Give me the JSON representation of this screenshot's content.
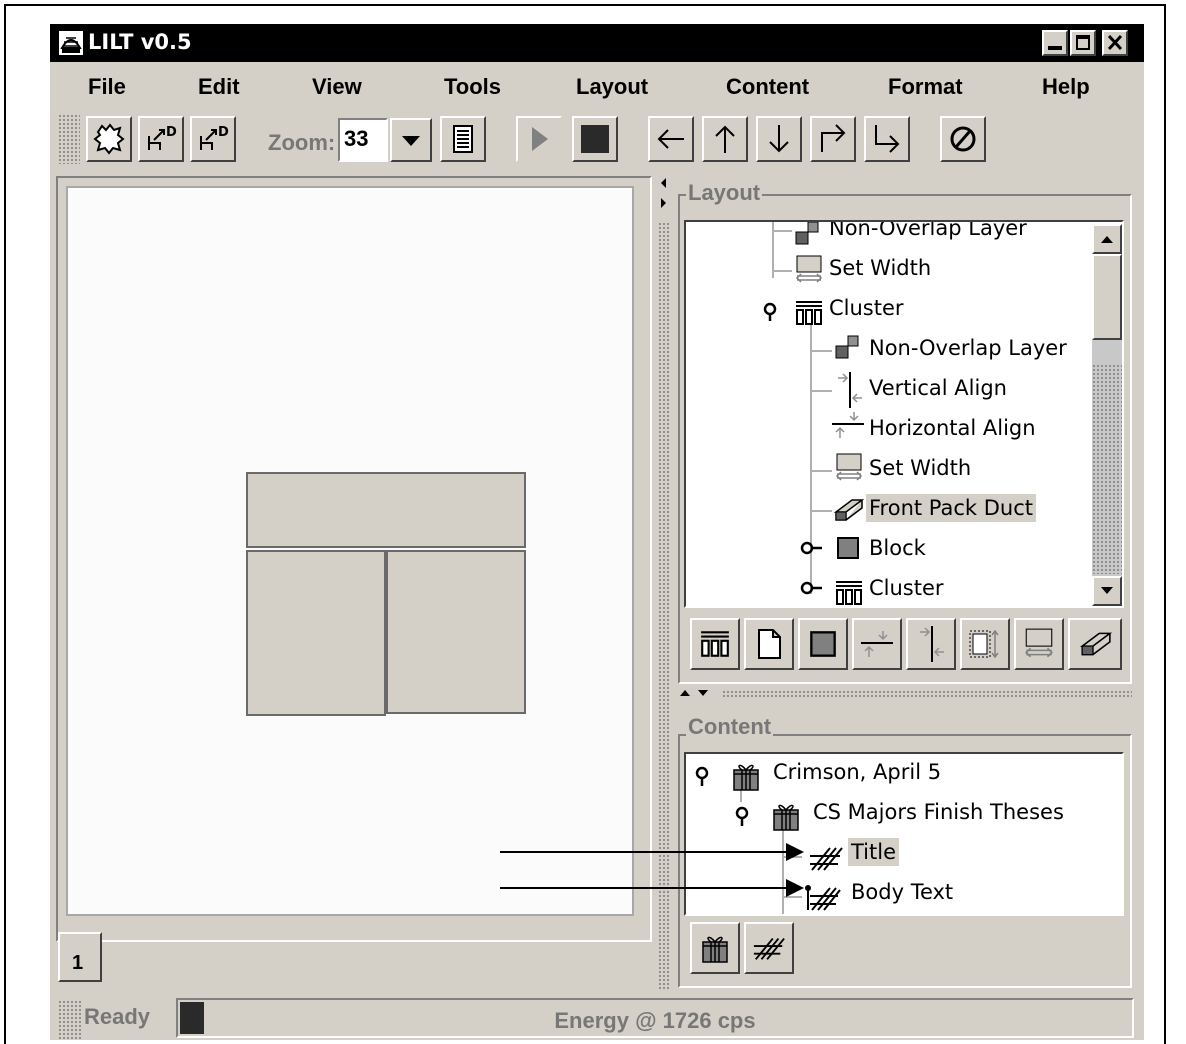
{
  "window": {
    "title": "LILT v0.5"
  },
  "menu": [
    "File",
    "Edit",
    "View",
    "Tools",
    "Layout",
    "Content",
    "Format",
    "Help"
  ],
  "toolbar": {
    "zoom_label": "Zoom:",
    "zoom_value": "33",
    "icons": [
      "new-layout-icon",
      "export-icon",
      "export-alt-icon",
      "dropdown-arrow-icon",
      "page-view-icon",
      "play-icon",
      "stop-icon",
      "arrow-left-icon",
      "arrow-up-icon",
      "arrow-down-icon",
      "redo-arrow-icon",
      "enter-arrow-icon",
      "cancel-icon"
    ]
  },
  "canvas": {
    "page_tab": "1"
  },
  "layout_panel": {
    "title": "Layout",
    "tree": [
      {
        "label": "Non-Overlap Layer",
        "icon": "non-overlap-layer-icon",
        "depth": 1
      },
      {
        "label": "Set Width",
        "icon": "set-width-icon",
        "depth": 1
      },
      {
        "label": "Cluster",
        "icon": "cluster-icon",
        "depth": 1,
        "expanded": true
      },
      {
        "label": "Non-Overlap Layer",
        "icon": "non-overlap-layer-icon",
        "depth": 2
      },
      {
        "label": "Vertical Align",
        "icon": "vertical-align-icon",
        "depth": 2
      },
      {
        "label": "Horizontal Align",
        "icon": "horizontal-align-icon",
        "depth": 2
      },
      {
        "label": "Set Width",
        "icon": "set-width-icon",
        "depth": 2
      },
      {
        "label": "Front Pack Duct",
        "icon": "pack-duct-icon",
        "depth": 2,
        "selected": true
      },
      {
        "label": "Block",
        "icon": "block-icon",
        "depth": 2,
        "collapsed": true
      },
      {
        "label": "Cluster",
        "icon": "cluster-icon",
        "depth": 2,
        "collapsed": true
      }
    ],
    "buttons": [
      "cluster-icon",
      "page-icon",
      "block-icon",
      "horizontal-align-icon",
      "vertical-align-icon",
      "set-height-icon",
      "set-width-icon",
      "pack-duct-icon"
    ]
  },
  "content_panel": {
    "title": "Content",
    "tree": [
      {
        "label": "Crimson, April 5",
        "icon": "gift-icon",
        "depth": 0,
        "expanded": true
      },
      {
        "label": "CS Majors Finish Theses",
        "icon": "gift-icon",
        "depth": 1,
        "expanded": true
      },
      {
        "label": "Title",
        "icon": "text-icon",
        "depth": 2,
        "selected": true
      },
      {
        "label": "Body Text",
        "icon": "body-text-icon",
        "depth": 2
      }
    ],
    "buttons": [
      "gift-icon",
      "text-icon"
    ]
  },
  "status": {
    "ready": "Ready",
    "energy": "Energy @ 1726 cps",
    "energy_level": 0.025
  }
}
